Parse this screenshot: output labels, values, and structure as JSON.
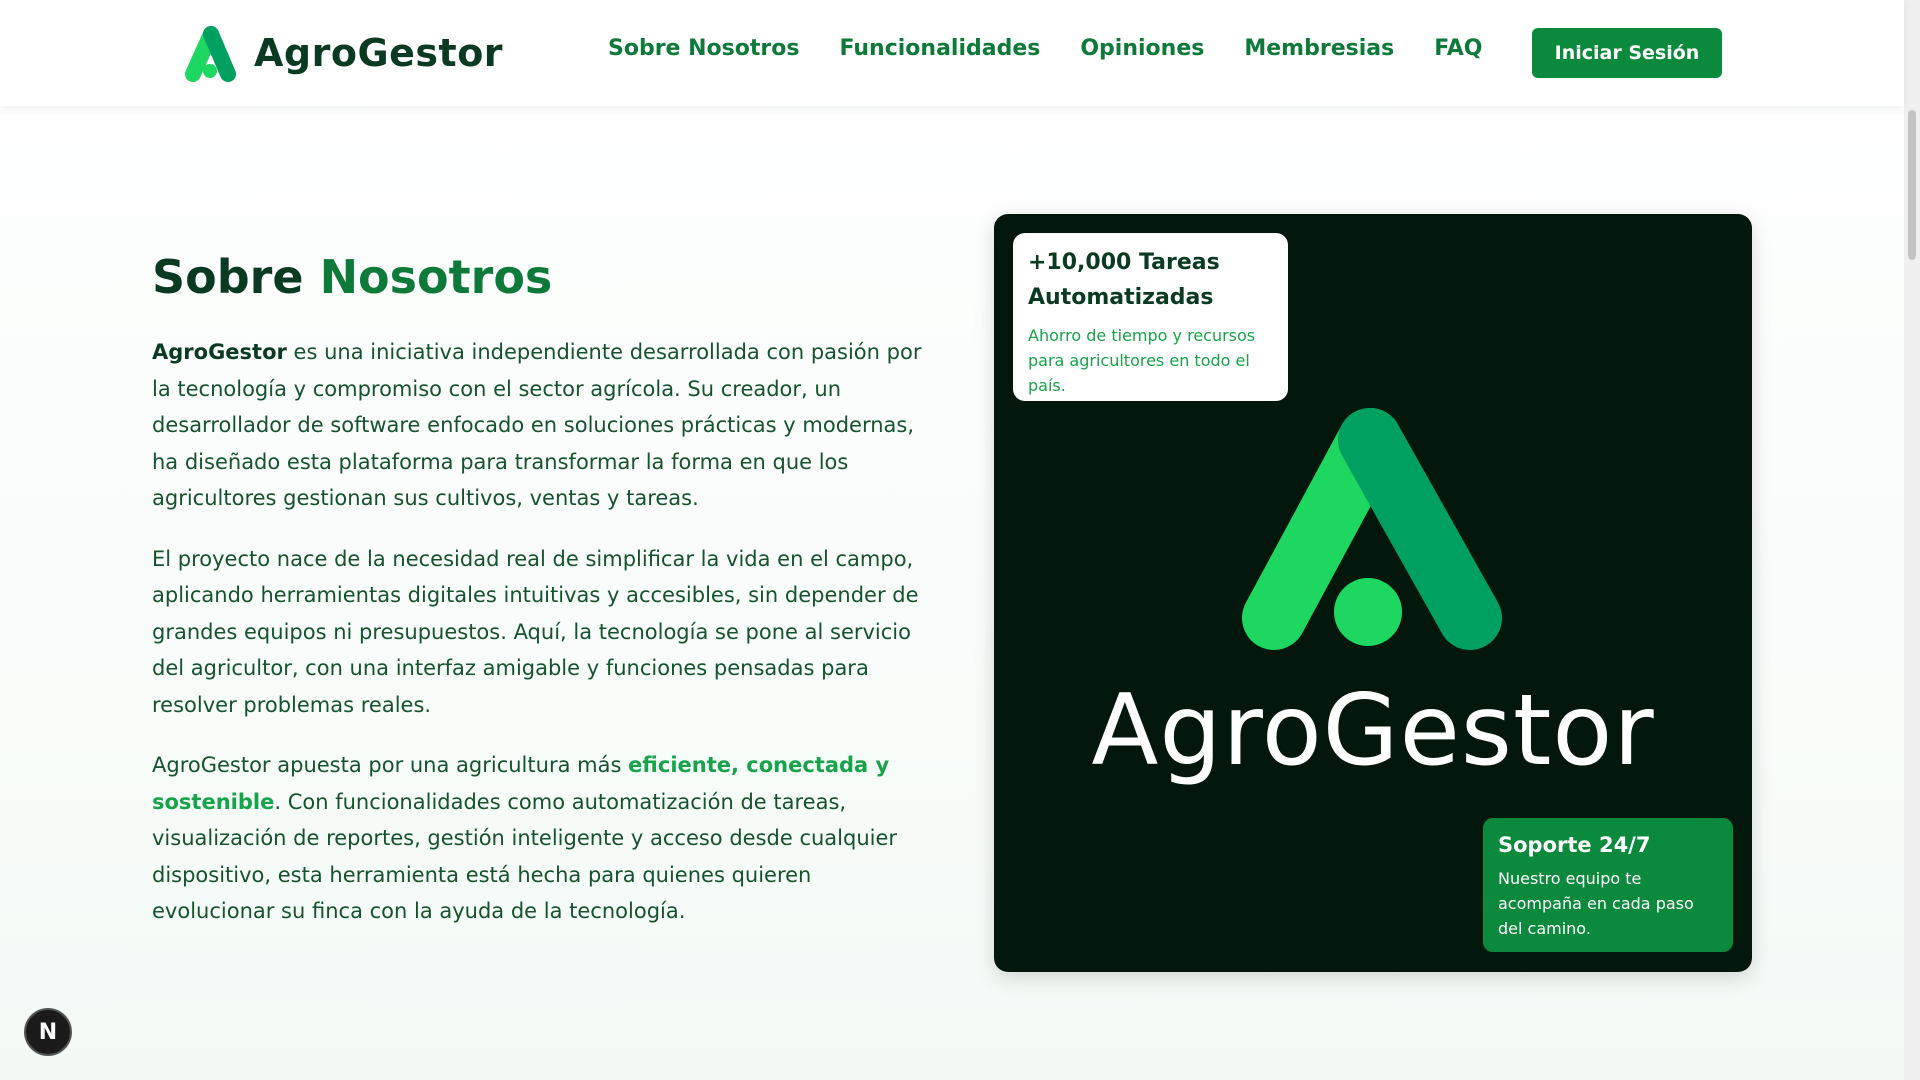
{
  "header": {
    "brand_name": "AgroGestor",
    "nav": [
      "Sobre Nosotros",
      "Funcionalidades",
      "Opiniones",
      "Membresias",
      "FAQ"
    ],
    "login_label": "Iniciar Sesión"
  },
  "about": {
    "title_part1": "Sobre",
    "title_part2": "Nosotros",
    "p1_brand": "AgroGestor",
    "p1_text": " es una iniciativa independiente desarrollada con pasión por la tecnología y compromiso con el sector agrícola. Su creador, un desarrollador de software enfocado en soluciones prácticas y modernas, ha diseñado esta plataforma para transformar la forma en que los agricultores gestionan sus cultivos, ventas y tareas.",
    "p2_text": "El proyecto nace de la necesidad real de simplificar la vida en el campo, aplicando herramientas digitales intuitivas y accesibles, sin depender de grandes equipos ni presupuestos. Aquí, la tecnología se pone al servicio del agricultor, con una interfaz amigable y funciones pensadas para resolver problemas reales.",
    "p3_before": "AgroGestor apuesta por una agricultura más ",
    "p3_highlight": "eficiente, conectada y sostenible",
    "p3_after": ". Con funcionalidades como automatización de tareas, visualización de reportes, gestión inteligente y acceso desde cualquier dispositivo, esta herramienta está hecha para quienes quieren evolucionar su finca con la ayuda de la tecnología."
  },
  "card": {
    "wordmark": "AgroGestor",
    "stat_title": "+10,000 Tareas Automatizadas",
    "stat_desc": "Ahorro de tiempo y recursos para agricultores en todo el país.",
    "support_title": "Soporte 24/7",
    "support_desc": "Nuestro equipo te acompaña en cada paso del camino."
  },
  "dev_badge": {
    "label": "N"
  },
  "colors": {
    "primary": "#0b8a3d",
    "nav_text": "#0e7a3a",
    "dark_text": "#0a3b22",
    "card_bg": "#03170d",
    "logo_light": "#1ed760",
    "logo_dark": "#00a060"
  },
  "icons": [
    "agrogestor-logo-icon",
    "nextjs-icon"
  ]
}
